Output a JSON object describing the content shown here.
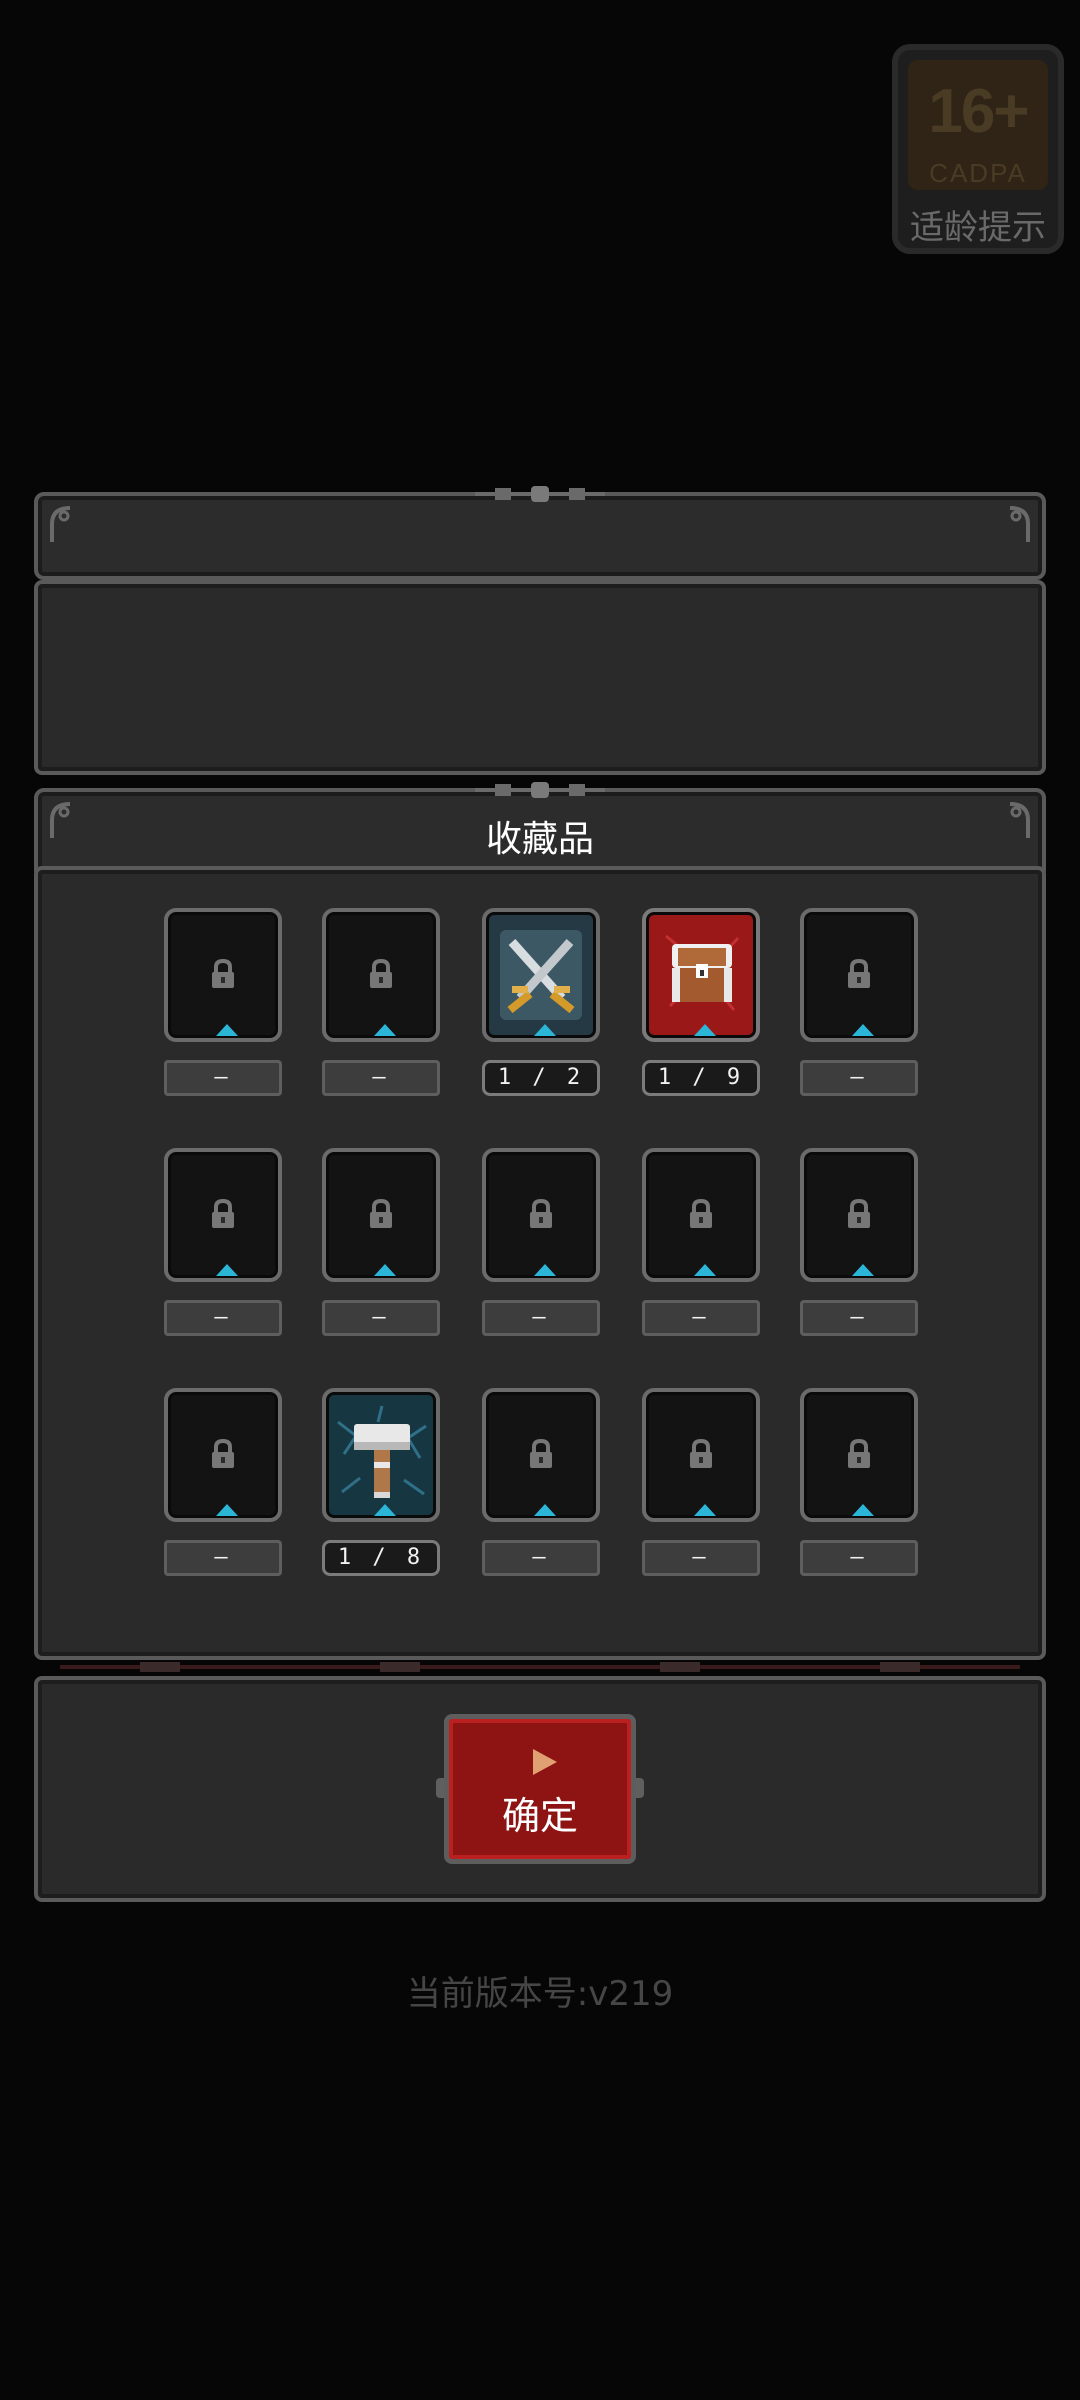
{
  "age_badge": {
    "rating": "16+",
    "org": "CADPA",
    "tip": "适龄提示"
  },
  "collection_panel": {
    "title": "收藏品",
    "items": [
      {
        "name": "locked",
        "count": "—"
      },
      {
        "name": "locked",
        "count": "—"
      },
      {
        "name": "crossed-swords-icon",
        "count": "1 / 2"
      },
      {
        "name": "treasure-chest-icon",
        "count": "1 / 9"
      },
      {
        "name": "locked",
        "count": "—"
      },
      {
        "name": "locked",
        "count": "—"
      },
      {
        "name": "locked",
        "count": "—"
      },
      {
        "name": "locked",
        "count": "—"
      },
      {
        "name": "locked",
        "count": "—"
      },
      {
        "name": "locked",
        "count": "—"
      },
      {
        "name": "locked",
        "count": "—"
      },
      {
        "name": "hammer-icon",
        "count": "1 / 8"
      },
      {
        "name": "locked",
        "count": "—"
      },
      {
        "name": "locked",
        "count": "—"
      },
      {
        "name": "locked",
        "count": "—"
      }
    ]
  },
  "confirm": {
    "label": "确定"
  },
  "version": "当前版本号:v219",
  "colors": {
    "background": "#060606",
    "panel": "#2a2a2a",
    "panel_border": "#5a5a5a",
    "accent_red": "#8e1414",
    "accent_cyan": "#2bb5d6"
  }
}
